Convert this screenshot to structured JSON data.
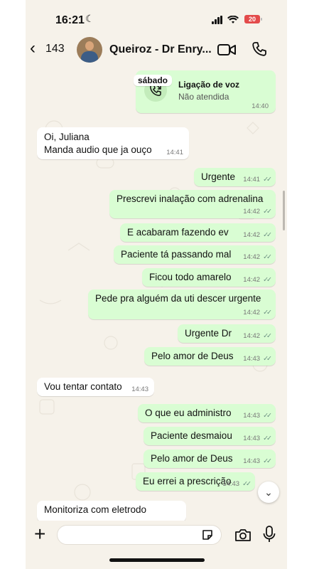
{
  "status_bar": {
    "time": "16:21",
    "battery": "20"
  },
  "header": {
    "back_count": "143",
    "contact_name": "Queiroz - Dr Enry..."
  },
  "call_message": {
    "day_chip": "sábado",
    "title": "Ligação de voz",
    "subtitle": "Não atendida",
    "time": "14:40"
  },
  "messages": [
    {
      "dir": "in",
      "lines": [
        "Oi, Juliana",
        "Manda audio que ja ouço"
      ],
      "time": "14:41"
    },
    {
      "dir": "out",
      "lines": [
        "Urgente"
      ],
      "time": "14:41"
    },
    {
      "dir": "out",
      "lines": [
        "Prescrevi inalação com adrenalina"
      ],
      "time": "14:42"
    },
    {
      "dir": "out",
      "lines": [
        "E acabaram  fazendo ev"
      ],
      "time": "14:42"
    },
    {
      "dir": "out",
      "lines": [
        "Paciente tá passando mal"
      ],
      "time": "14:42"
    },
    {
      "dir": "out",
      "lines": [
        "Ficou todo amarelo"
      ],
      "time": "14:42"
    },
    {
      "dir": "out",
      "lines": [
        "Pede pra alguém da uti descer urgente"
      ],
      "time": "14:42"
    },
    {
      "dir": "out",
      "lines": [
        "Urgente Dr"
      ],
      "time": "14:42"
    },
    {
      "dir": "out",
      "lines": [
        "Pelo amor de Deus"
      ],
      "time": "14:43"
    },
    {
      "dir": "in",
      "lines": [
        "Vou tentar contato"
      ],
      "time": "14:43"
    },
    {
      "dir": "out",
      "lines": [
        "O que eu administro"
      ],
      "time": "14:43"
    },
    {
      "dir": "out",
      "lines": [
        "Paciente desmaiou"
      ],
      "time": "14:43"
    },
    {
      "dir": "out",
      "lines": [
        "Pelo amor de Deus"
      ],
      "time": "14:43"
    },
    {
      "dir": "out",
      "lines": [
        "Eu errei a prescrição"
      ],
      "time": "14:43"
    },
    {
      "dir": "in",
      "lines": [
        "Monitoriza com eletrodo"
      ],
      "time": ""
    }
  ],
  "tick_glyph": "✓✓",
  "scroll_down_glyph": "⌄",
  "composer": {
    "plus": "+",
    "placeholder": ""
  },
  "icons": [
    "back-chevron-icon",
    "avatar",
    "video-call-icon",
    "phone-call-icon",
    "missed-call-icon",
    "plus-icon",
    "sticker-icon",
    "camera-icon",
    "microphone-icon",
    "scroll-down-icon"
  ],
  "colors": {
    "outgoing_bubble": "#d9fdd3",
    "incoming_bubble": "#ffffff",
    "chat_background": "#f6f2ea",
    "battery_low": "#e34b4b",
    "tick": "#6a8f80"
  }
}
